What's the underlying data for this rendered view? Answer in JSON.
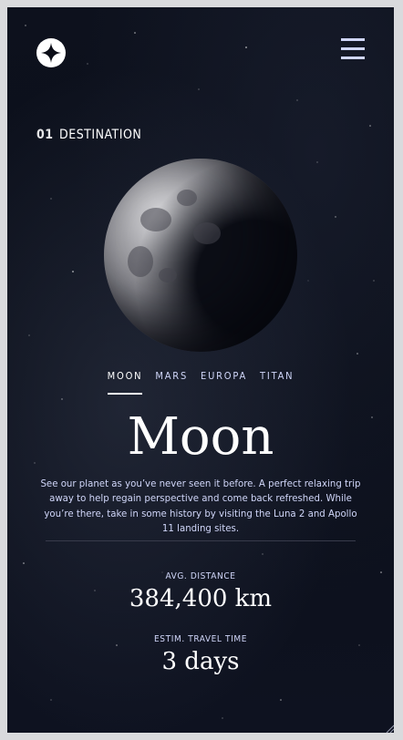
{
  "header": {
    "logo_icon": "star-logo-icon",
    "menu_icon": "hamburger-menu-icon"
  },
  "heading": {
    "number": "01",
    "label": "DESTINATION"
  },
  "planet_image": "moon",
  "tabs": [
    {
      "label": "MOON",
      "active": true
    },
    {
      "label": "MARS",
      "active": false
    },
    {
      "label": "EUROPA",
      "active": false
    },
    {
      "label": "TITAN",
      "active": false
    }
  ],
  "destination": {
    "name": "Moon",
    "description": "See our planet as you’ve never seen it before. A perfect relaxing trip away to help regain perspective and come back refreshed. While you’re there, take in some history by visiting the Luna 2 and Apollo 11 landing sites."
  },
  "stats": {
    "distance_label": "AVG. DISTANCE",
    "distance_value": "384,400 km",
    "travel_label": "ESTIM. TRAVEL TIME",
    "travel_value": "3 days"
  },
  "colors": {
    "background": "#0b0d17",
    "accent_light": "#d0d6f9",
    "white": "#ffffff"
  }
}
